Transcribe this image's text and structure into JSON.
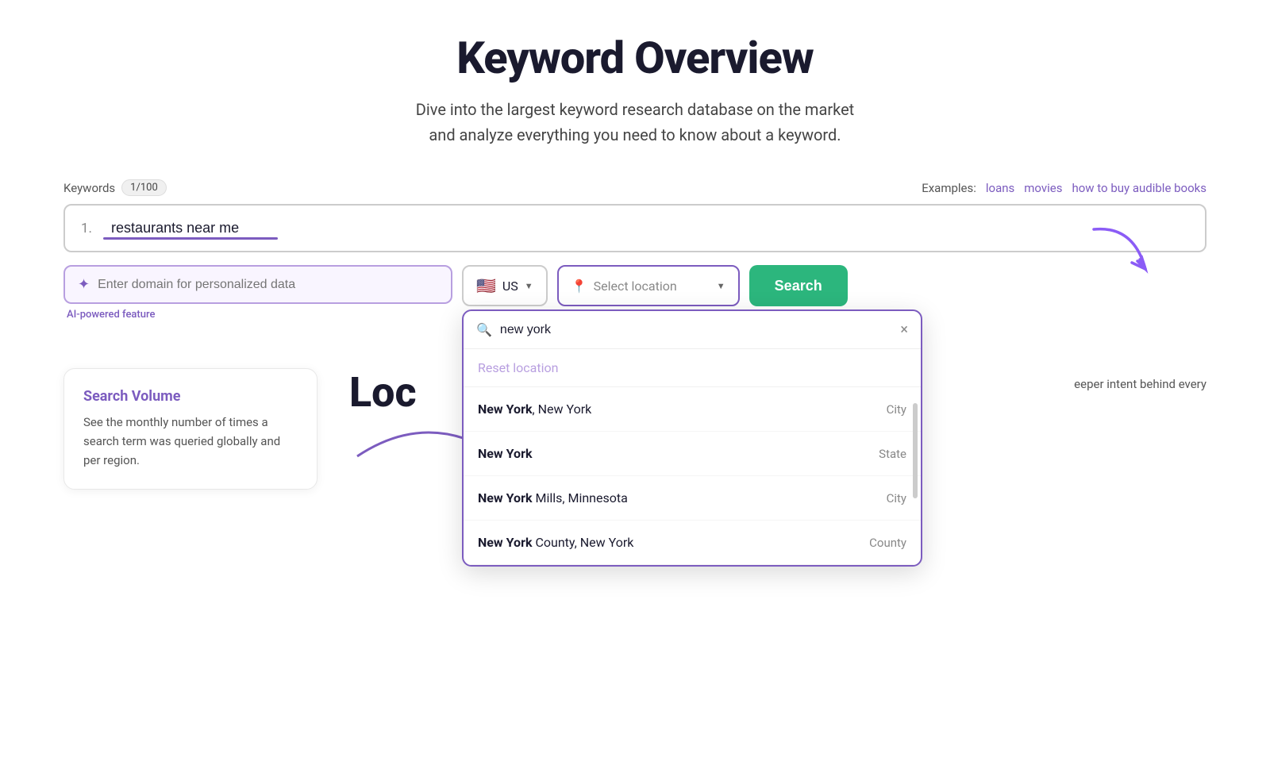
{
  "page": {
    "title": "Keyword Overview",
    "subtitle_line1": "Dive into the largest keyword research database on the market",
    "subtitle_line2": "and analyze everything you need to know about a keyword."
  },
  "keywords_label": "Keywords",
  "keywords_badge": "1/100",
  "examples_label": "Examples:",
  "examples": [
    {
      "text": "loans"
    },
    {
      "text": "movies"
    },
    {
      "text": "how to buy audible books"
    }
  ],
  "keyword_row": {
    "number": "1.",
    "value": "restaurants near me"
  },
  "domain_input": {
    "placeholder": "Enter domain for personalized data",
    "ai_label": "AI-powered feature"
  },
  "country_selector": {
    "flag": "🇺🇸",
    "value": "US"
  },
  "location_selector": {
    "placeholder": "Select location"
  },
  "search_button": "Search",
  "dropdown": {
    "search_value": "new york",
    "reset_label": "Reset location",
    "items": [
      {
        "bold": "New York",
        "rest": ", New York",
        "type": "City"
      },
      {
        "bold": "New York",
        "rest": "",
        "type": "State"
      },
      {
        "bold": "New York",
        "rest": " Mills, Minnesota",
        "type": "City"
      },
      {
        "bold": "New York",
        "rest": " County, New York",
        "type": "County"
      }
    ]
  },
  "bottom": {
    "loc_title": "Loc",
    "info_card": {
      "title": "Search Volume",
      "text": "See the monthly number of times a search term was queried globally and per region."
    },
    "right_text": "eeper intent behind every"
  }
}
